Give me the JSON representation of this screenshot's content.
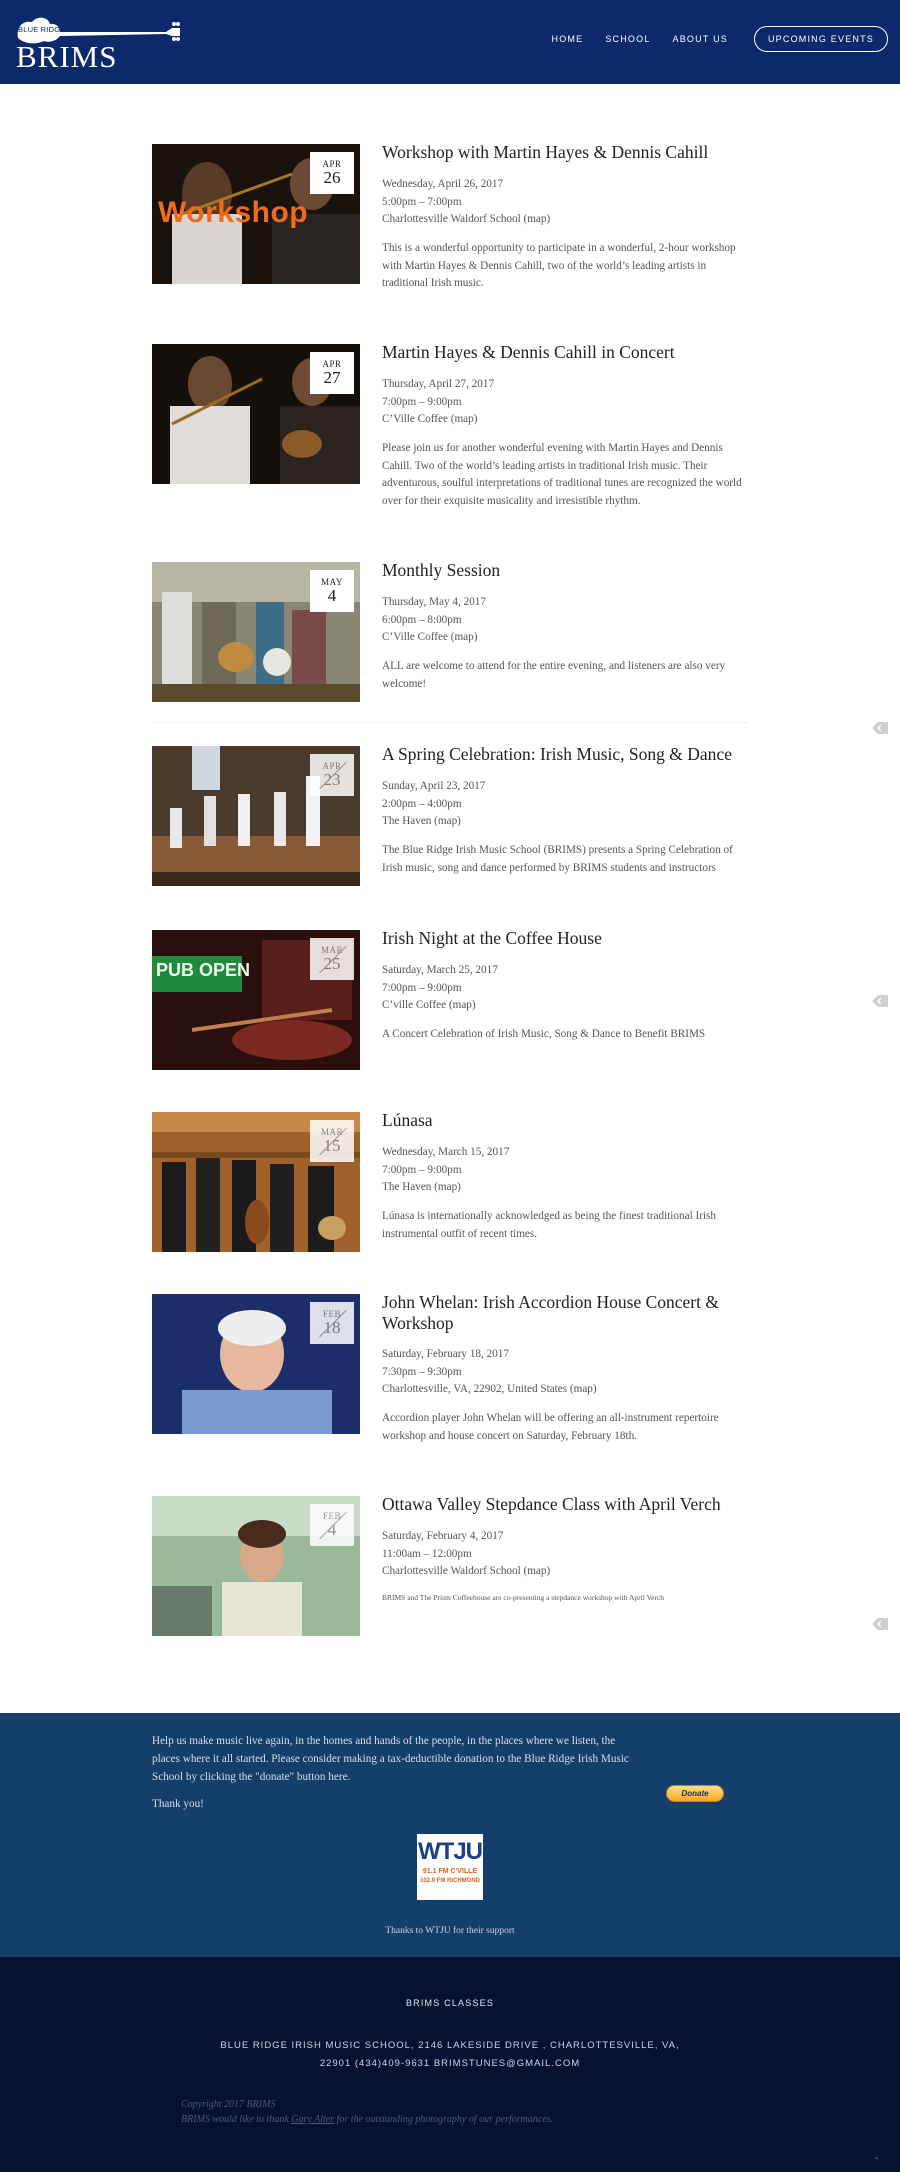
{
  "header": {
    "logo_small": "BLUE RIDGE IRISH MUSIC SCHOOL",
    "logo_big": "BRIMS",
    "nav": [
      "HOME",
      "SCHOOL",
      "ABOUT US"
    ],
    "cta": "UPCOMING EVENTS"
  },
  "events": [
    {
      "month": "APR",
      "day": "26",
      "title": "Workshop with Martin Hayes & Dennis Cahill",
      "date": "Wednesday, April 26, 2017",
      "time": "5:00pm – 7:00pm",
      "venue": "Charlottesville Waldorf School (map)",
      "desc": "This is a wonderful opportunity to participate in a wonderful, 2-hour workshop with Martin Hayes & Dennis Cahill, two of the world’s leading artists in traditional Irish music.",
      "image_overlay": "Workshop"
    },
    {
      "month": "APR",
      "day": "27",
      "title": "Martin Hayes & Dennis Cahill in Concert",
      "date": "Thursday, April 27, 2017",
      "time": "7:00pm – 9:00pm",
      "venue": "C’Ville Coffee (map)",
      "desc": "Please join us for another wonderful evening with Martin Hayes and Dennis Cahill. Two of the world’s leading artists in traditional Irish music. Their adventurous, soulful interpretations of traditional tunes are recognized the world over for their exquisite musicality and irresistible rhythm."
    },
    {
      "month": "MAY",
      "day": "4",
      "title": "Monthly Session",
      "date": "Thursday, May 4, 2017",
      "time": "6:00pm – 8:00pm",
      "venue": "C’Ville Coffee (map)",
      "desc": "ALL are welcome to attend for the entire evening, and listeners are also very welcome!"
    },
    {
      "month": "APR",
      "day": "23",
      "title": "A Spring Celebration: Irish Music, Song & Dance",
      "date": "Sunday, April 23, 2017",
      "time": "2:00pm – 4:00pm",
      "venue": "The Haven (map)",
      "desc": "The Blue Ridge Irish Music School (BRIMS) presents a Spring Celebration of Irish music, song and dance performed by BRIMS students and instructors"
    },
    {
      "month": "MAR",
      "day": "25",
      "title": "Irish Night at the Coffee House",
      "date": "Saturday, March 25, 2017",
      "time": "7:00pm – 9:00pm",
      "venue": "C’ville Coffee (map)",
      "desc": "A Concert Celebration of Irish Music, Song & Dance to Benefit BRIMS",
      "image_overlay": "PUB OPEN"
    },
    {
      "month": "MAR",
      "day": "15",
      "title": "Lúnasa",
      "date": "Wednesday, March 15, 2017",
      "time": "7:00pm – 9:00pm",
      "venue": "The Haven (map)",
      "desc": "Lúnasa is internationally acknowledged as being the finest traditional Irish instrumental outfit of recent times."
    },
    {
      "month": "FEB",
      "day": "18",
      "title": "John Whelan: Irish Accordion House Concert & Workshop",
      "date": "Saturday, February 18, 2017",
      "time": "7:30pm – 9:30pm",
      "venue": "Charlottesville, VA, 22902, United States (map)",
      "desc": "Accordion player John Whelan will be offering an all-instrument repertoire workshop and house concert on Saturday, February 18th."
    },
    {
      "month": "FEB",
      "day": "4",
      "title": "Ottawa Valley Stepdance Class with April Verch",
      "date": "Saturday, February 4, 2017",
      "time": "11:00am – 12:00pm",
      "venue": "Charlottesville Waldorf School (map)",
      "desc": "BRIMS and The Prism Coffeehouse are co-presenting a stepdance workshop with April Verch"
    }
  ],
  "donate": {
    "text": "Help us make music live again, in the homes and hands of the people, in the places where we listen, the places where it all started. Please consider making a tax-deductible donation to the Blue Ridge Irish Music School by clicking the \"donate\" button here.",
    "thanks": "Thank you!",
    "button": "Donate",
    "wtju_logo": "WTJU",
    "wtju_freq1": "91.1 FM C'VILLE",
    "wtju_freq2": "102.9 FM RICHMOND",
    "wtju_thanks": "Thanks to WTJU for their support"
  },
  "footer": {
    "classes": "BRIMS CLASSES",
    "address_line1": "BLUE RIDGE IRISH MUSIC SCHOOL, 2146 LAKESIDE DRIVE , CHARLOTTESVILLE, VA,",
    "address_line2": "22901   (434)409-9631   BRIMSTUNES@GMAIL.COM",
    "copyright": "Copyright 2017 BRIMS",
    "credit_pre": "BRIMS would like to thank ",
    "credit_link": "Gary Alter",
    "credit_post": " for the outstanding photography of our performances."
  },
  "colors": {
    "header_bg": "#0c2a6b",
    "donate_bg": "#143f6b",
    "footer_bg": "#061330"
  }
}
